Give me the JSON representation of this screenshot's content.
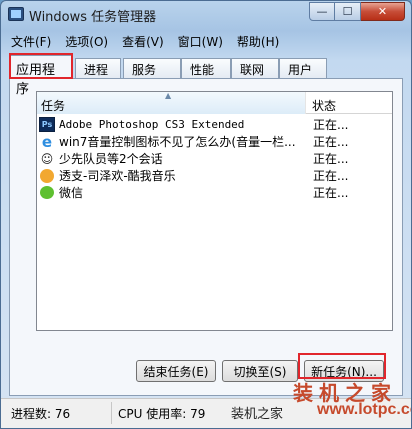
{
  "window": {
    "title": "Windows 任务管理器"
  },
  "menu": [
    "文件(F)",
    "选项(O)",
    "查看(V)",
    "窗口(W)",
    "帮助(H)"
  ],
  "tabs": [
    "应用程序",
    "进程",
    "服务",
    "性能",
    "联网",
    "用户"
  ],
  "table": {
    "columns": [
      "任务",
      "状态"
    ],
    "rows": [
      {
        "name": "Adobe Photoshop CS3 Extended",
        "status": "正在...",
        "icon": "photoshop-icon"
      },
      {
        "name": "win7音量控制图标不见了怎么办(音量一栏...",
        "status": "正在...",
        "icon": "ie-icon"
      },
      {
        "name": "少先队员等2个会话",
        "status": "正在...",
        "icon": "qq-icon"
      },
      {
        "name": "透支-司泽欢-酷我音乐",
        "status": "正在...",
        "icon": "kuwo-music-icon"
      },
      {
        "name": "微信",
        "status": "正在...",
        "icon": "wechat-icon"
      }
    ]
  },
  "buttons": {
    "end_task": "结束任务(E)",
    "switch_to": "切换至(S)",
    "new_task": "新任务(N)..."
  },
  "status_bar": {
    "processes": "进程数: 76",
    "cpu": "CPU 使用率: 79"
  },
  "watermark": {
    "brand": "装机之家",
    "small": "装机之家",
    "url": "www.lotpc.com"
  },
  "colors": {
    "highlight": "#e1262c"
  }
}
